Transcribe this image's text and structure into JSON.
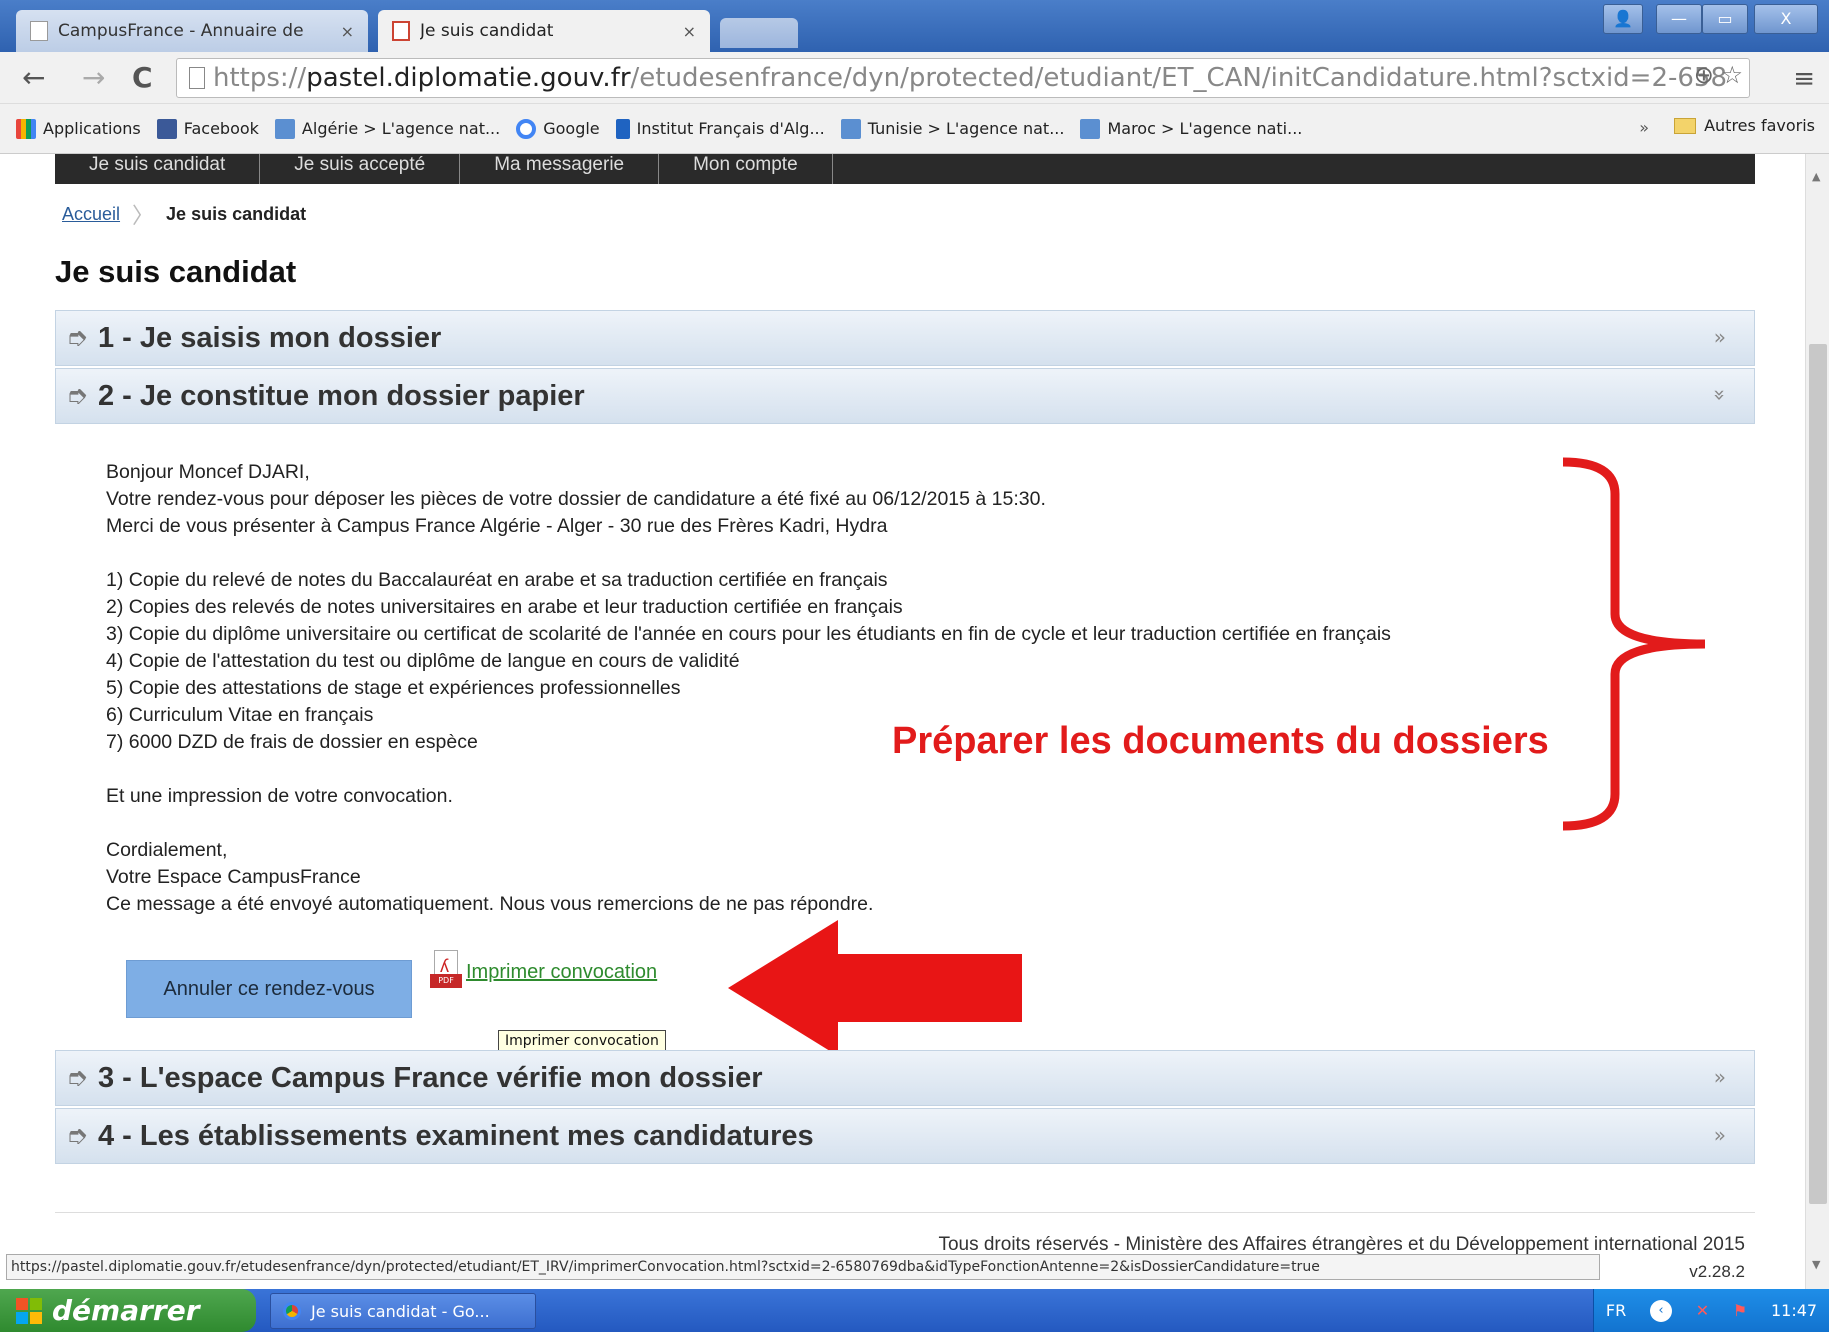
{
  "browser": {
    "tabs": [
      {
        "label": "CampusFrance - Annuaire de",
        "close": "×"
      },
      {
        "label": "Je suis candidat",
        "close": "×"
      }
    ],
    "window_controls": {
      "user": "👤",
      "minimize": "—",
      "maximize": "▭",
      "close": "X"
    },
    "nav": {
      "back": "←",
      "forward": "→",
      "reload": "C"
    },
    "url": {
      "scheme": "https://",
      "host": "pastel.diplomatie.gouv.fr",
      "path": "/etudesenfrance/dyn/protected/etudiant/ET_CAN/initCandidature.html?sctxid=2-658"
    },
    "omnibox_icons": "⊕ ☆",
    "menu_icon": "≡",
    "bookmarks": [
      {
        "label": "Applications",
        "color": "#e8453c"
      },
      {
        "label": "Facebook",
        "color": "#3b5998"
      },
      {
        "label": "Algérie > L'agence nat...",
        "color": "#5b8fd1"
      },
      {
        "label": "Google",
        "color": "#4285f4"
      },
      {
        "label": "Institut Français d'Alg...",
        "color": "#1f63c1"
      },
      {
        "label": "Tunisie > L'agence nat...",
        "color": "#5b8fd1"
      },
      {
        "label": "Maroc > L'agence nati...",
        "color": "#5b8fd1"
      }
    ],
    "bookmarks_more": "»",
    "other_bookmarks": "Autres favoris",
    "status_url": "https://pastel.diplomatie.gouv.fr/etudesenfrance/dyn/protected/etudiant/ET_IRV/imprimerConvocation.html?sctxid=2-6580769dba&idTypeFonctionAntenne=2&isDossierCandidature=true"
  },
  "page": {
    "top_nav": [
      "Je suis candidat",
      "Je suis accepté",
      "Ma messagerie",
      "Mon compte"
    ],
    "breadcrumb": {
      "home": "Accueil",
      "current": "Je suis candidat"
    },
    "title": "Je suis candidat",
    "steps": [
      {
        "title": "1 - Je saisis mon dossier",
        "toggle": "»"
      },
      {
        "title": "2 - Je constitue mon dossier papier",
        "toggle": "»"
      },
      {
        "title": "3 - L'espace Campus France vérifie mon dossier",
        "toggle": "»"
      },
      {
        "title": "4 - Les établissements examinent mes candidatures",
        "toggle": "»"
      }
    ],
    "message": {
      "greeting": "Bonjour Moncef DJARI,",
      "line1": "Votre rendez-vous pour déposer les pièces de votre dossier de candidature a été fixé au 06/12/2015 à 15:30.",
      "line2": "Merci de vous présenter à Campus France Algérie - Alger - 30 rue des Frères Kadri, Hydra",
      "items": [
        "1) Copie du relevé de notes du Baccalauréat en arabe et sa traduction certifiée en français",
        "2) Copies des relevés de notes universitaires en arabe et leur traduction certifiée en français",
        "3) Copie du diplôme universitaire ou certificat de scolarité de l'année en cours pour les étudiants en fin de cycle et leur traduction certifiée en français",
        "4) Copie de l'attestation du test ou diplôme de langue en cours de validité",
        "5) Copie des attestations de stage et expériences professionnelles",
        "6) Curriculum Vitae en français",
        "7) 6000 DZD de frais de dossier en espèce"
      ],
      "print_note": "Et une impression de votre convocation.",
      "closing": "Cordialement,",
      "signature": "Votre Espace CampusFrance",
      "auto_note": "Ce message a été envoyé automatiquement. Nous vous remercions de ne pas répondre."
    },
    "cancel_button": "Annuler ce rendez-vous",
    "print_link": "Imprimer convocation",
    "pdf_tag": "PDF",
    "tooltip": "Imprimer convocation",
    "annotation": "Préparer les documents du dossiers",
    "footer": "Tous droits réservés - Ministère des Affaires étrangères et du Développement international 2015",
    "version": "v2.28.2"
  },
  "taskbar": {
    "start": "démarrer",
    "task": "Je suis candidat - Go...",
    "lang": "FR",
    "time": "11:47"
  },
  "colors": {
    "annotation": "#e21b1b",
    "link_green": "#2e8b2e",
    "button_blue": "#7eaee5"
  }
}
